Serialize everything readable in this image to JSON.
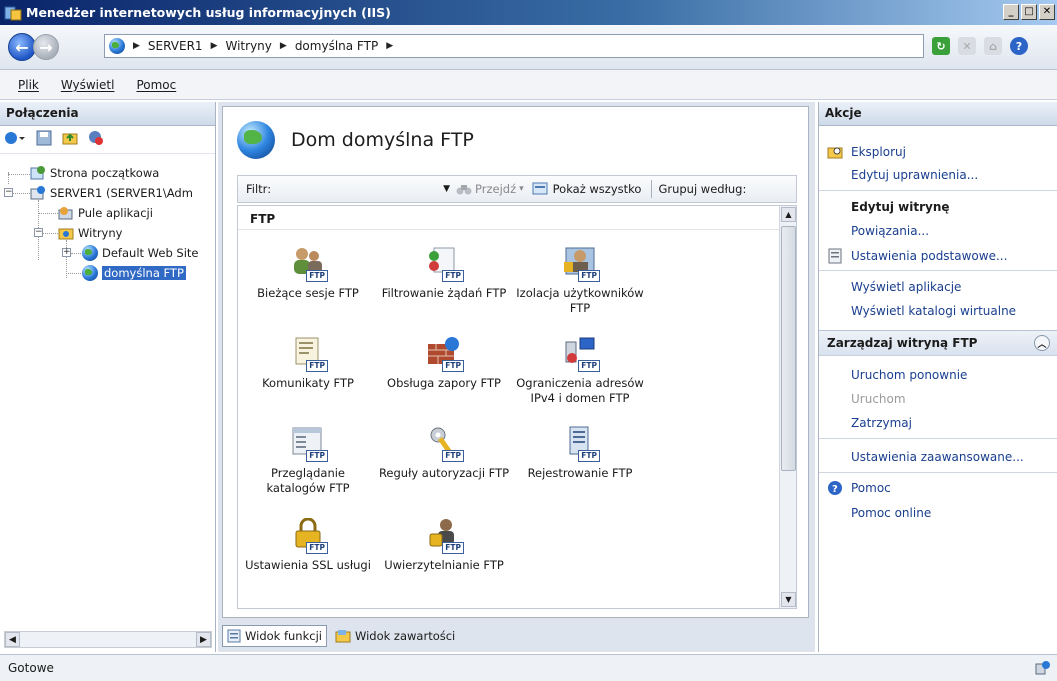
{
  "window": {
    "title": "Menedżer internetowych usług informacyjnych (IIS)"
  },
  "address": {
    "crumbs": [
      "SERVER1",
      "Witryny",
      "domyślna FTP"
    ]
  },
  "menu": [
    "Plik",
    "Wyświetl",
    "Pomoc"
  ],
  "connections": {
    "title": "Połączenia",
    "tree": {
      "start": "Strona początkowa",
      "server": "SERVER1 (SERVER1\\Adm",
      "pools": "Pule aplikacji",
      "sites": "Witryny",
      "default_site": "Default Web Site",
      "ftp_site": "domyślna FTP"
    }
  },
  "main": {
    "title": "Dom domyślna FTP",
    "filter_label": "Filtr:",
    "go_label": "Przejdź",
    "show_all_label": "Pokaż wszystko",
    "group_by_label": "Grupuj według:",
    "group_header": "FTP",
    "features": [
      {
        "label": "Bieżące sesje FTP",
        "icon": "users-icon"
      },
      {
        "label": "Filtrowanie żądań FTP",
        "icon": "filter-icon"
      },
      {
        "label": "Izolacja użytkowników FTP",
        "icon": "isolation-icon"
      },
      {
        "label": "Komunikaty FTP",
        "icon": "message-icon"
      },
      {
        "label": "Obsługa zapory FTP",
        "icon": "firewall-icon"
      },
      {
        "label": "Ograniczenia adresów IPv4 i domen FTP",
        "icon": "network-icon"
      },
      {
        "label": "Przeglądanie katalogów FTP",
        "icon": "browse-icon"
      },
      {
        "label": "Reguły autoryzacji FTP",
        "icon": "key-icon"
      },
      {
        "label": "Rejestrowanie FTP",
        "icon": "log-icon"
      },
      {
        "label": "Ustawienia SSL usługi",
        "icon": "lock-icon"
      },
      {
        "label": "Uwierzytelnianie FTP",
        "icon": "auth-icon"
      }
    ],
    "view_features": "Widok funkcji",
    "view_content": "Widok zawartości"
  },
  "actions": {
    "title": "Akcje",
    "explore": "Eksploruj",
    "edit_permissions": "Edytuj uprawnienia...",
    "edit_site_header": "Edytuj witrynę",
    "bindings": "Powiązania...",
    "basic_settings": "Ustawienia podstawowe...",
    "view_apps": "Wyświetl aplikacje",
    "view_vdirs": "Wyświetl katalogi wirtualne",
    "manage_header": "Zarządzaj witryną FTP",
    "restart": "Uruchom ponownie",
    "start": "Uruchom",
    "stop": "Zatrzymaj",
    "advanced": "Ustawienia zaawansowane...",
    "help": "Pomoc",
    "help_online": "Pomoc online"
  },
  "status": {
    "text": "Gotowe"
  },
  "colors": {
    "accent": "#1a3f8f",
    "selection": "#316ac5",
    "title_start": "#0a246a"
  }
}
